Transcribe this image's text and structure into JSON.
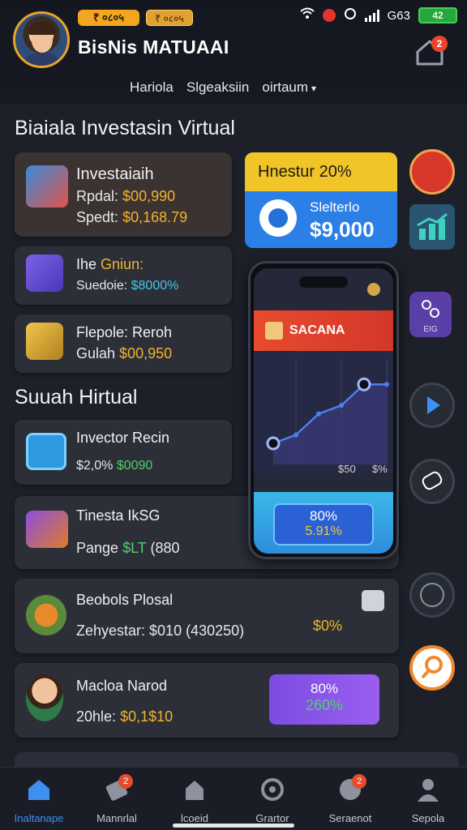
{
  "status_bar": {
    "badge_yellow": "₹ ०८०५",
    "badge_red": "₹ ०८०५",
    "carrier": "G63",
    "battery": "42"
  },
  "header": {
    "app_title": "BisNis MATUAAI",
    "notification_count": "2"
  },
  "nav": {
    "items": [
      "Hariola",
      "Slgeaksiin"
    ],
    "dropdown": "oirtaum"
  },
  "section1": {
    "title": "Biaiala Investasin Virtual",
    "cards": [
      {
        "title": "Investaiaih",
        "line1_label": "Rpdal:",
        "line1_value": "$00,990",
        "line2_label": "Spedt:",
        "line2_value": "$0,168.79"
      },
      {
        "title_a": "Ihe",
        "title_b": "Gniun:",
        "line_label": "Suedoie:",
        "line_value": "$8000%"
      },
      {
        "title": "Flepole: Reroh",
        "line_label": "Gulah",
        "line_value": "$00,950"
      }
    ],
    "banner": {
      "heading": "Hnestur 20%",
      "label": "Slelterlo",
      "value": "$9,000"
    }
  },
  "section2": {
    "title": "Suuah Hirtual",
    "cards": [
      {
        "title": "Invector Recin",
        "line_a": "$2,0%",
        "line_b": "$0090"
      },
      {
        "title": "Tinesta IkSG",
        "line_label": "Pange",
        "line_value_green": "$LT",
        "line_value": "(880"
      },
      {
        "title": "Beobols Plosal",
        "line": "Zehyestar: $010 (430250)",
        "percent": "$0%"
      },
      {
        "title": "Macloa Narod",
        "line_label": "20hle:",
        "line_value": "$0,1$10",
        "btn_top": "80%",
        "btn_bottom": "260%"
      }
    ]
  },
  "phone": {
    "banner": "SACANA",
    "tick1": "$50",
    "tick2": "$%",
    "btn_top": "80%",
    "btn_bottom": "5.91%"
  },
  "side_icons": {
    "badge_label": "EIG"
  },
  "bottom_nav": {
    "items": [
      "Inaltanape",
      "Mannrlal",
      "lcoeid",
      "Grartor",
      "Seraenot",
      "Sepola"
    ],
    "badge": "2"
  },
  "chart_data": {
    "type": "line",
    "x": [
      1,
      2,
      3,
      4,
      5,
      6
    ],
    "values": [
      10,
      14,
      24,
      28,
      38,
      38
    ],
    "ylim": [
      0,
      50
    ]
  },
  "colors": {
    "accent": "#2b7fe6",
    "warning": "#f2b42b",
    "alert": "#e8452c"
  }
}
